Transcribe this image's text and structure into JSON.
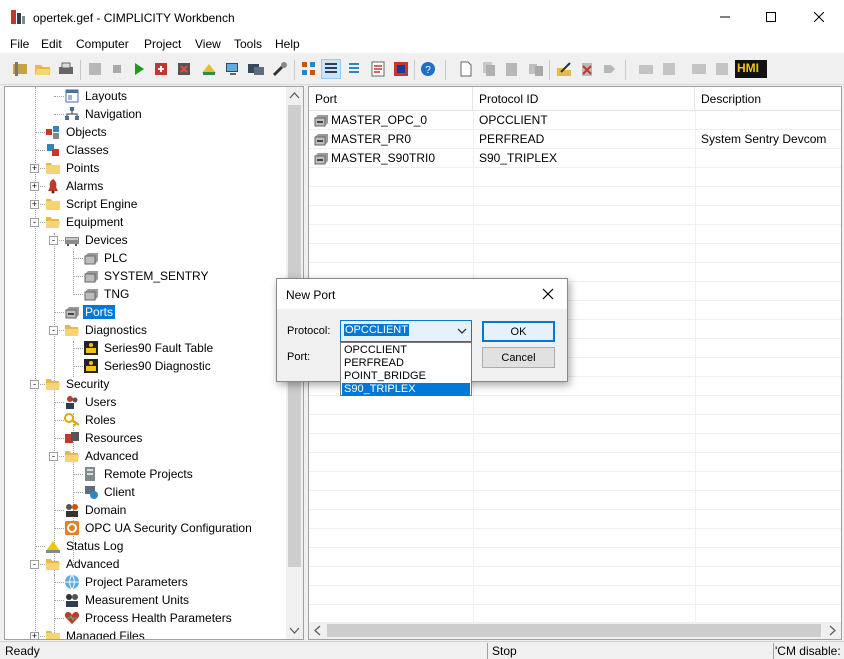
{
  "window": {
    "title": "opertek.gef - CIMPLICITY Workbench"
  },
  "menu": [
    "File",
    "Edit",
    "Computer",
    "Project",
    "View",
    "Tools",
    "Help"
  ],
  "toolbar": {
    "hmi_label": "HMI"
  },
  "tree": {
    "items": [
      {
        "label": "Layouts",
        "icon": "layouts-icon"
      },
      {
        "label": "Navigation",
        "icon": "navigation-icon"
      },
      {
        "label": "Objects",
        "icon": "objects-icon"
      },
      {
        "label": "Classes",
        "icon": "classes-icon"
      },
      {
        "label": "Points",
        "icon": "folder-icon"
      },
      {
        "label": "Alarms",
        "icon": "alarms-icon"
      },
      {
        "label": "Script Engine",
        "icon": "folder-icon"
      },
      {
        "label": "Equipment",
        "icon": "folder-open-icon"
      },
      {
        "label": "Devices",
        "icon": "devices-icon"
      },
      {
        "label": "PLC",
        "icon": "device-icon"
      },
      {
        "label": "SYSTEM_SENTRY",
        "icon": "device-icon"
      },
      {
        "label": "TNG",
        "icon": "device-icon"
      },
      {
        "label": "Ports",
        "icon": "port-icon",
        "selected": true
      },
      {
        "label": "Diagnostics",
        "icon": "folder-open-icon"
      },
      {
        "label": "Series90 Fault Table",
        "icon": "diagnostic-icon"
      },
      {
        "label": "Series90 Diagnostic",
        "icon": "diagnostic-icon"
      },
      {
        "label": "Security",
        "icon": "folder-open-icon"
      },
      {
        "label": "Users",
        "icon": "users-icon"
      },
      {
        "label": "Roles",
        "icon": "roles-icon"
      },
      {
        "label": "Resources",
        "icon": "resources-icon"
      },
      {
        "label": "Advanced",
        "icon": "folder-open-icon"
      },
      {
        "label": "Remote Projects",
        "icon": "remote-projects-icon"
      },
      {
        "label": "Client",
        "icon": "client-icon"
      },
      {
        "label": "Domain",
        "icon": "domain-icon"
      },
      {
        "label": "OPC UA Security Configuration",
        "icon": "opcua-icon"
      },
      {
        "label": "Status Log",
        "icon": "status-log-icon"
      },
      {
        "label": "Advanced",
        "icon": "folder-open-icon"
      },
      {
        "label": "Project Parameters",
        "icon": "globe-icon"
      },
      {
        "label": "Measurement Units",
        "icon": "measurement-icon"
      },
      {
        "label": "Process Health Parameters",
        "icon": "heart-icon"
      },
      {
        "label": "Managed Files",
        "icon": "folder-icon"
      }
    ]
  },
  "list": {
    "columns": [
      "Port",
      "Protocol ID",
      "Description"
    ],
    "rows": [
      {
        "port": "MASTER_OPC_0",
        "protocol": "OPCCLIENT",
        "description": ""
      },
      {
        "port": "MASTER_PR0",
        "protocol": "PERFREAD",
        "description": "System Sentry Devcom"
      },
      {
        "port": "MASTER_S90TRI0",
        "protocol": "S90_TRIPLEX",
        "description": ""
      }
    ]
  },
  "dialog": {
    "title": "New Port",
    "protocol_label": "Protocol:",
    "port_label": "Port:",
    "protocol_value": "OPCCLIENT",
    "protocol_options": [
      "OPCCLIENT",
      "PERFREAD",
      "POINT_BRIDGE",
      "S90_TRIPLEX"
    ],
    "highlighted_option": "S90_TRIPLEX",
    "ok_label": "OK",
    "cancel_label": "Cancel"
  },
  "status": {
    "left": "Ready",
    "middle": "Stop",
    "right": "'CM disable:"
  },
  "colors": {
    "selection": "#0078d7",
    "folder": "#f5d476"
  }
}
